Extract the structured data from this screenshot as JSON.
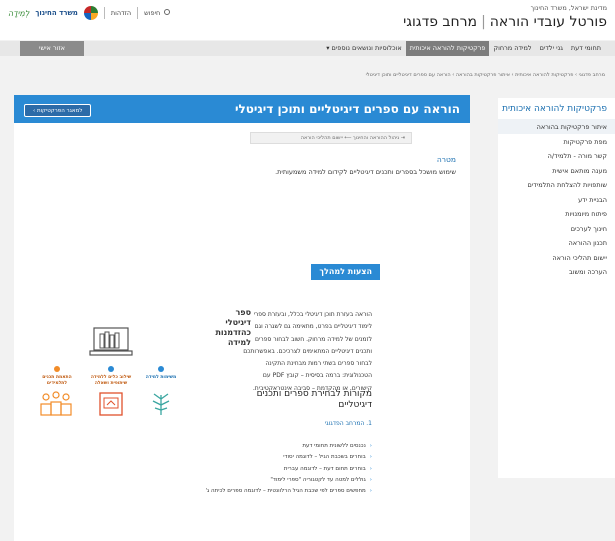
{
  "header": {
    "gov_line": "מדינת ישראל, משרד החינוך",
    "title_part1": "פורטל עובדי הוראה",
    "title_part2": "מרחב פדגוגי",
    "brand_name": "משרד החינוך",
    "brand_script": "לְמִידָה",
    "login_label": "הזדהות",
    "search_label": "חיפוש"
  },
  "nav": {
    "tabs": [
      {
        "label": "תחומי דעת"
      },
      {
        "label": "גני ילדים"
      },
      {
        "label": "למידה מרחוק"
      },
      {
        "label": "פרקטיקות להוראה איכותית"
      },
      {
        "label": "אוכלוסיות ונושאים נוספים"
      }
    ],
    "personal_area": "אזור אישי"
  },
  "breadcrumbs": "מרחב פדגוגי › פרקטיקות להוראה איכותית › איתור פרקטיקות בהוראה › הוראה עם ספרים דיגיטליים ותוכן דיגיטלי",
  "sidebar": {
    "title": "פרקטיקות להוראה איכותית",
    "items": [
      {
        "label": "איתור פרקטיקות בהוראה"
      },
      {
        "label": "מפת פרקטיקות"
      },
      {
        "label": "קשר מורה - תלמיד/ה"
      },
      {
        "label": "מענה מותאם אישית"
      },
      {
        "label": "שותפויות להצלחת התלמידים"
      },
      {
        "label": "הבניית ידע"
      },
      {
        "label": "פיתוח מיומנויות"
      },
      {
        "label": "חינוך לערכים"
      },
      {
        "label": "תכנון ההוראה"
      },
      {
        "label": "יישום תהליכי הוראה"
      },
      {
        "label": "הערכה ומשוב"
      }
    ]
  },
  "main": {
    "title": "הוראה עם ספרים דיגיטליים ותוכן דיגיטלי",
    "back_button": "למאגר הפרקטיקות ›",
    "tag_path": "ניהול ההוראה והחינוך  ⟵  יישום תהליכי הוראה",
    "goal_heading": "מטרה",
    "goal_text": "שימוש מושכל בספרים ותכנים דיגיטליים לקידום למידה משמעותית."
  },
  "proposal": {
    "heading": "הצעות למהלך",
    "book_title": "ספר דיגיטלי כהזדמנות למידה",
    "description": "הוראה בעזרת תוכן דיגיטלי בכלל, ובעזרת ספרי לימוד דיגיטליים בפרט, מתאימה גם לשגרה וגם לזמנים של למידה מרחוק. חשוב לבחור ספרים ותכנים דיגיטליים המתאימים לצרכיכם. באפשרותכם לבחור ספרים בשתי רמות מבחינת התקינה הטכנולוגית: ברמה בסיסית – קובץ PDF עם קישורים, או מהקדמת – סביבה אינטראקטיבית.",
    "icons": [
      {
        "label": "משימות למידה",
        "num": "1"
      },
      {
        "label": "שילוב כלים ללמידה שיתופית ושאלה",
        "num": "2"
      },
      {
        "label": "התאמת תכנים לתלמידים",
        "num": "3"
      }
    ],
    "sources_heading": "מקורות לבחירת ספרים ותכנים דיגיטליים",
    "sources_sub": "1. המרחב הפדגוגי",
    "sources": [
      "נכנסים ללשונית תחומי דעת",
      "בוחרים בשכבת הגיל – לדוגמה יסודי",
      "בוחרים תחום דעת – לדוגמה עברית",
      "גוללים למטה עד לקטגוריה \"ספרי לימוד\"",
      "מחפשים ספרים לפי שכבת הגיל הרלוונטית – לדוגמה ספרים לכיתה ג'"
    ]
  },
  "colors": {
    "accent": "#2a8ad4",
    "brand_green": "#3a8d3a",
    "icon_orange": "#f28c28"
  }
}
